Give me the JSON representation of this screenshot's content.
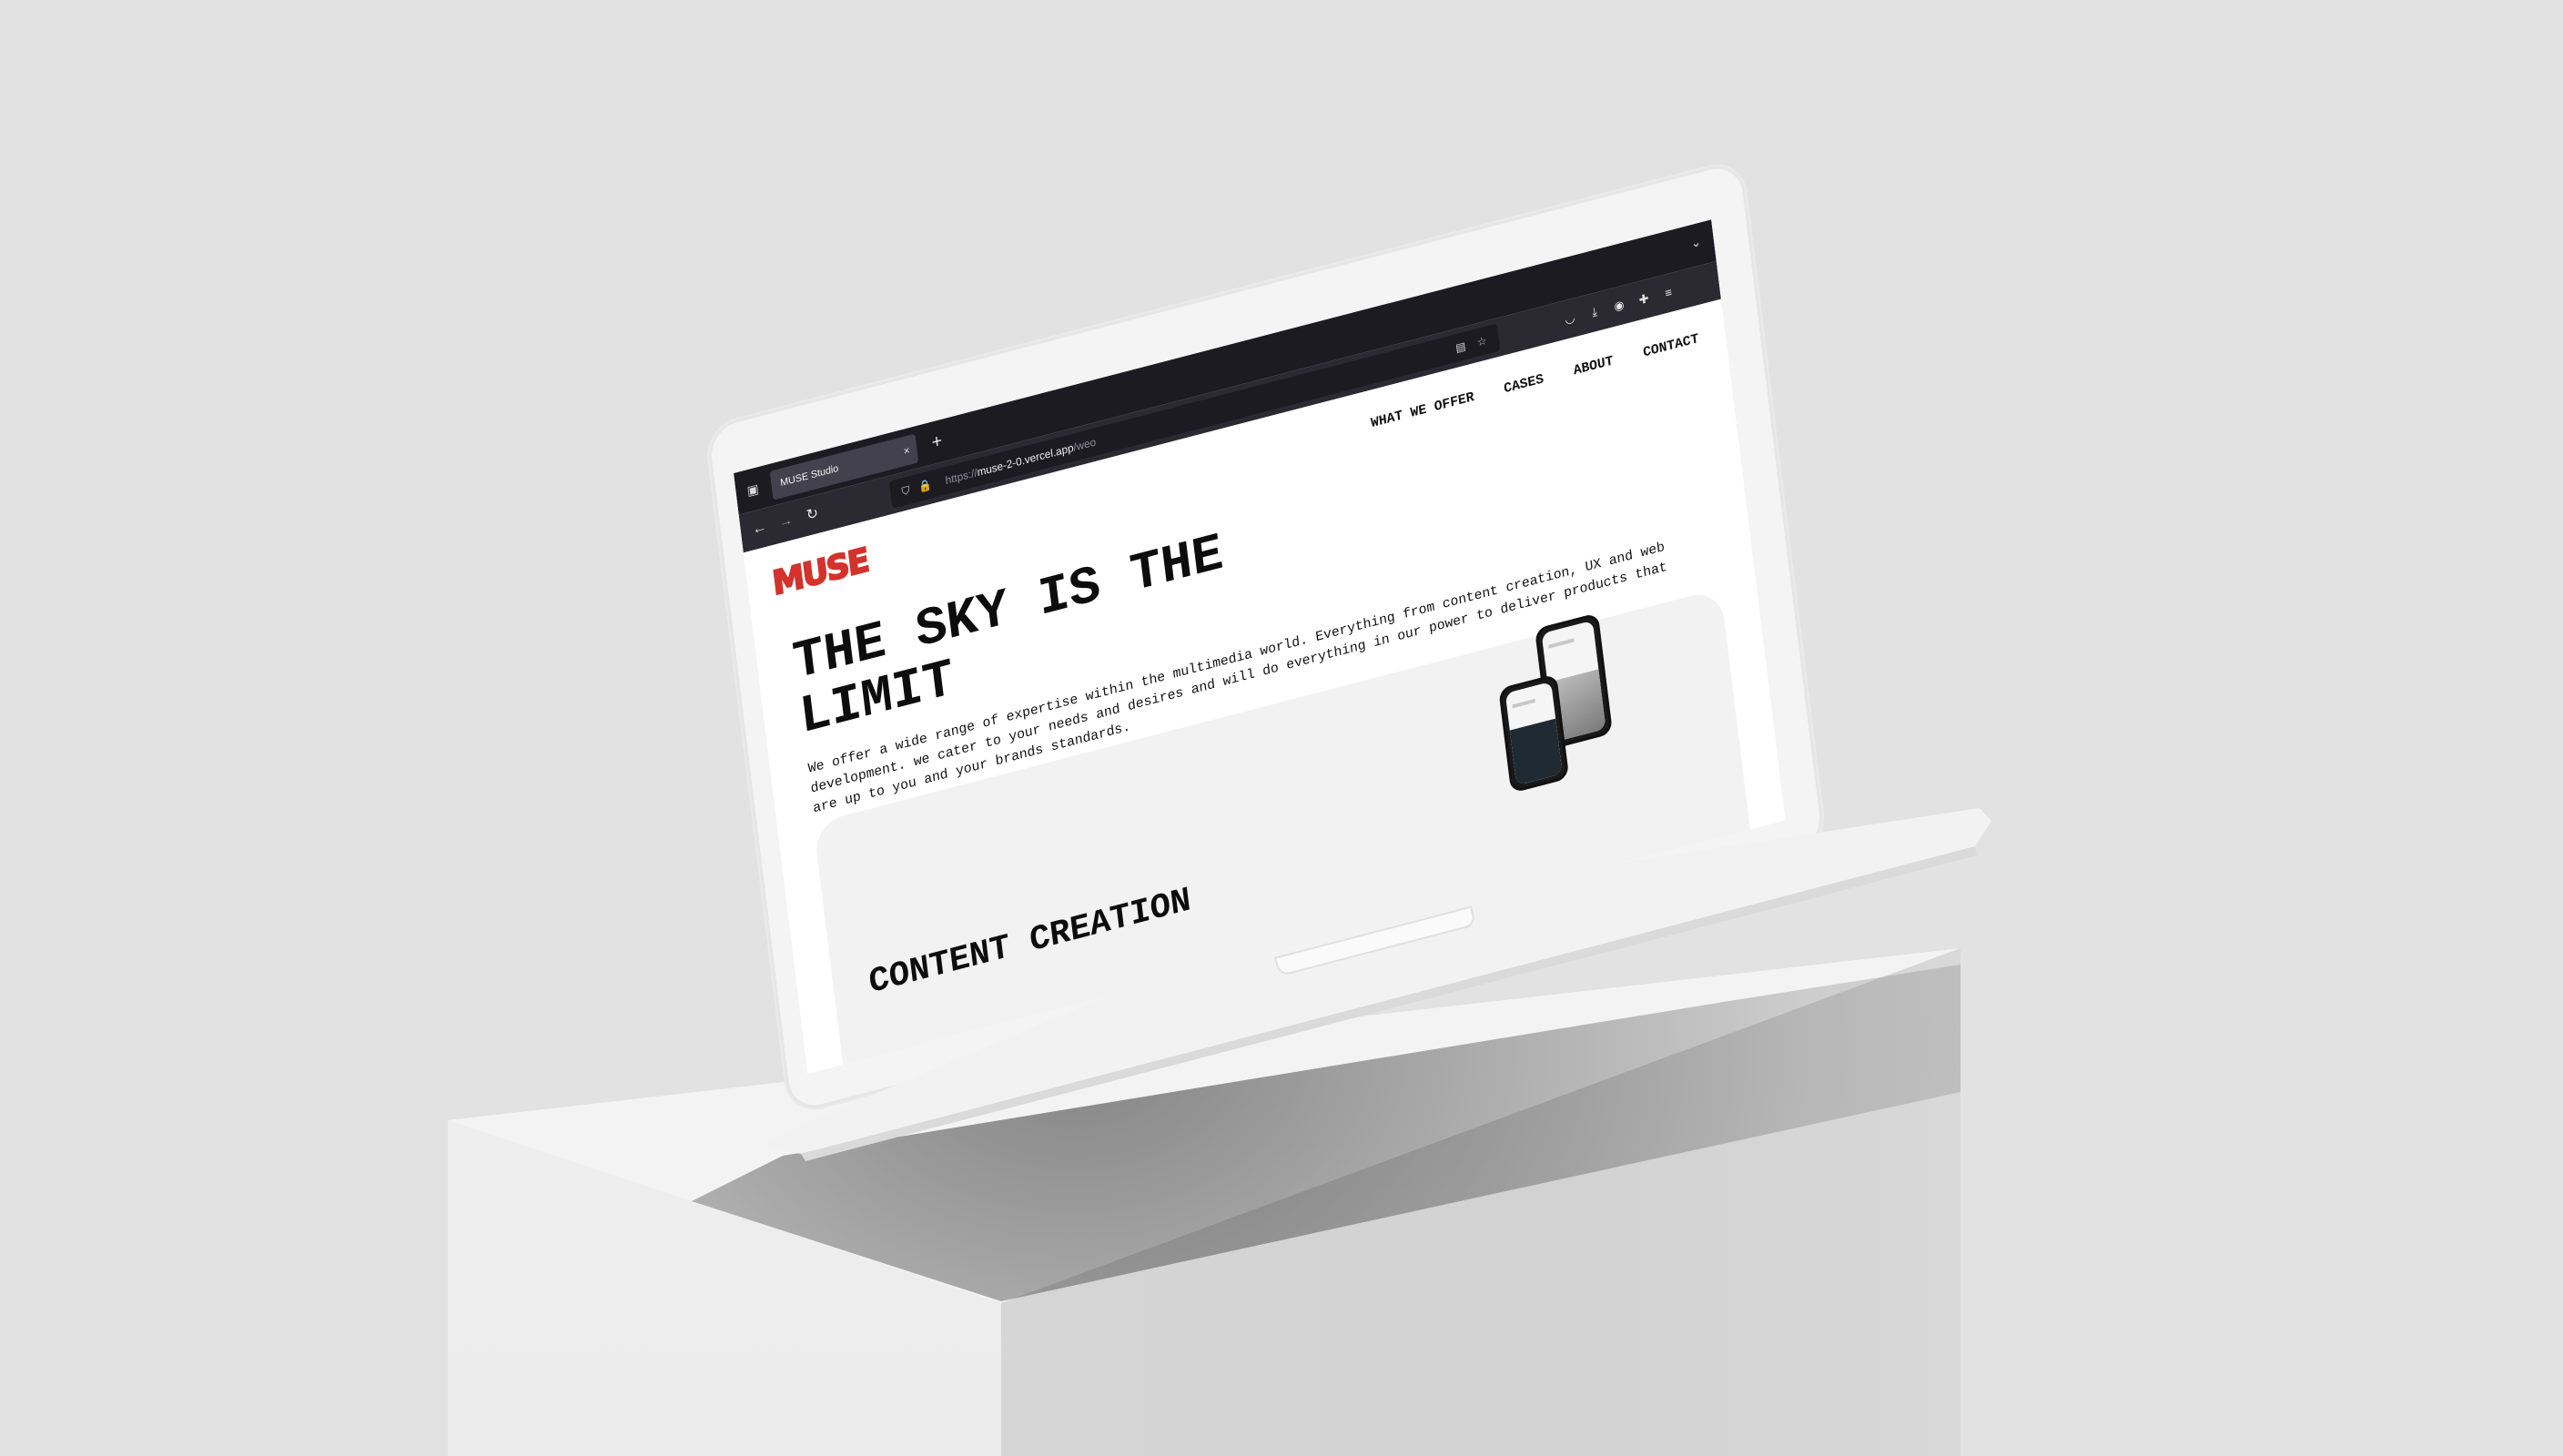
{
  "browser": {
    "tab_title": "MUSE Studio",
    "tab_close": "×",
    "new_tab": "+",
    "url_scheme": "https://",
    "url_host": "muse-2-0.vercel.app",
    "url_path": "/weo",
    "icons": {
      "tab_list": "tab-list-icon",
      "back": "arrow-left-icon",
      "forward": "arrow-right-icon",
      "reload": "reload-icon",
      "shield": "shield-icon",
      "lock": "lock-icon",
      "reader": "reader-view-icon",
      "bookmark": "star-icon",
      "pocket": "pocket-icon",
      "downloads": "download-icon",
      "account": "account-icon",
      "extensions": "puzzle-icon",
      "menu": "hamburger-menu-icon",
      "list_all_tabs": "chevron-down-icon"
    }
  },
  "site": {
    "logo": "MUSE",
    "brand_color": "#d3332c",
    "nav": [
      "WHAT WE OFFER",
      "CASES",
      "ABOUT",
      "CONTACT"
    ],
    "hero_title": "THE SKY IS THE LIMIT",
    "hero_text": "We offer a wide range of expertise within the multimedia world. Everything from content creation, UX and web development. we cater to your needs and desires and will do everything in our power to deliver products that are up to you and your brands standards.",
    "card_title": "CONTENT CREATION"
  }
}
